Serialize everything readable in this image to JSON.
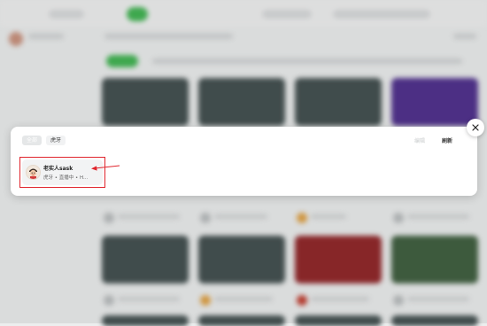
{
  "tabs": [
    {
      "label": "全部",
      "active": true
    },
    {
      "label": "虎牙",
      "active": false
    }
  ],
  "header_actions": {
    "muted": "编辑",
    "refresh": "刷新"
  },
  "streamer_card": {
    "name": "老实人sask",
    "status": "虎牙 • 直播中 • H..."
  },
  "icons": {
    "close": "close-icon",
    "avatar": "cartoon-avatar",
    "pointer": "red-arrow-annotation"
  },
  "colors": {
    "highlight": "#e0242c",
    "accent_green": "#3bb34d"
  }
}
